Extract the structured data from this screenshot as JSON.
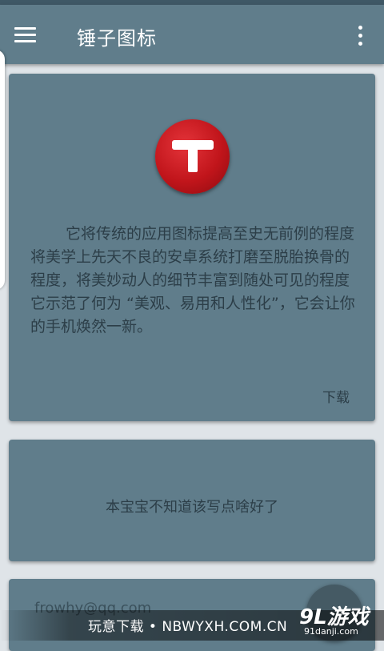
{
  "toolbar": {
    "title": "锤子图标",
    "menu_icon": "hamburger-menu-icon",
    "overflow_icon": "more-vert-icon",
    "color": "#607d8b"
  },
  "card1": {
    "logo_icon": "smartisan-t-logo",
    "logo_color": "#c1151b",
    "description": "它将传统的应用图标提高至史无前例的程度将美学上先天不良的安卓系统打磨至脱胎换骨的程度，将美妙动人的细节丰富到随处可见的程度它示范了何为 “美观、易用和人性化”，它会让你的手机焕然一新。",
    "download_label": "下载"
  },
  "card2": {
    "text": "本宝宝不知道该写点啥好了"
  },
  "card3": {
    "email": "frowhy@qq.com"
  },
  "watermark": {
    "text": "玩意下载 • NBWYXH.COM.CN",
    "logo_text": "9L游戏",
    "domain": "91danji.com"
  }
}
